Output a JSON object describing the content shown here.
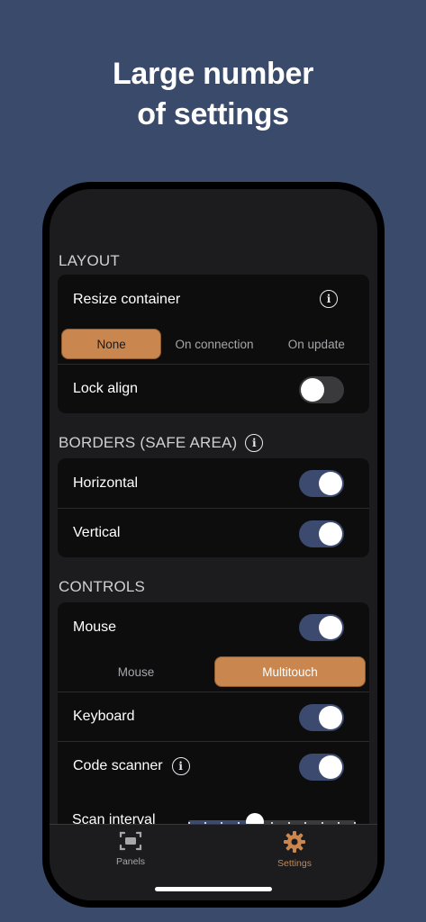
{
  "headline": {
    "line1": "Large number",
    "line2": "of settings"
  },
  "colors": {
    "background": "#3a4a6b",
    "accent": "#c9864e",
    "toggle_on": "#3b4a6e",
    "card": "#0d0d0d"
  },
  "layout_section": {
    "title": "LAYOUT",
    "resize_container": {
      "label": "Resize container",
      "icon": "info-icon"
    },
    "resize_options": [
      "None",
      "On connection",
      "On update"
    ],
    "resize_selected": "None",
    "lock_align": {
      "label": "Lock align",
      "on": false
    }
  },
  "borders_section": {
    "title": "BORDERS (SAFE AREA)",
    "icon": "info-icon",
    "horizontal": {
      "label": "Horizontal",
      "on": true
    },
    "vertical": {
      "label": "Vertical",
      "on": true
    }
  },
  "controls_section": {
    "title": "CONTROLS",
    "mouse": {
      "label": "Mouse",
      "on": true
    },
    "mouse_modes": [
      "Mouse",
      "Multitouch"
    ],
    "mouse_mode_selected": "Multitouch",
    "keyboard": {
      "label": "Keyboard",
      "on": true
    },
    "code_scanner": {
      "label": "Code scanner",
      "on": true,
      "icon": "info-icon"
    },
    "scan_interval": {
      "label": "Scan interval",
      "steps": 10,
      "value_step": 4
    }
  },
  "tabbar": {
    "panels": {
      "label": "Panels",
      "icon": "scan-frame-icon"
    },
    "settings": {
      "label": "Settings",
      "icon": "gear-icon",
      "active": true
    }
  }
}
